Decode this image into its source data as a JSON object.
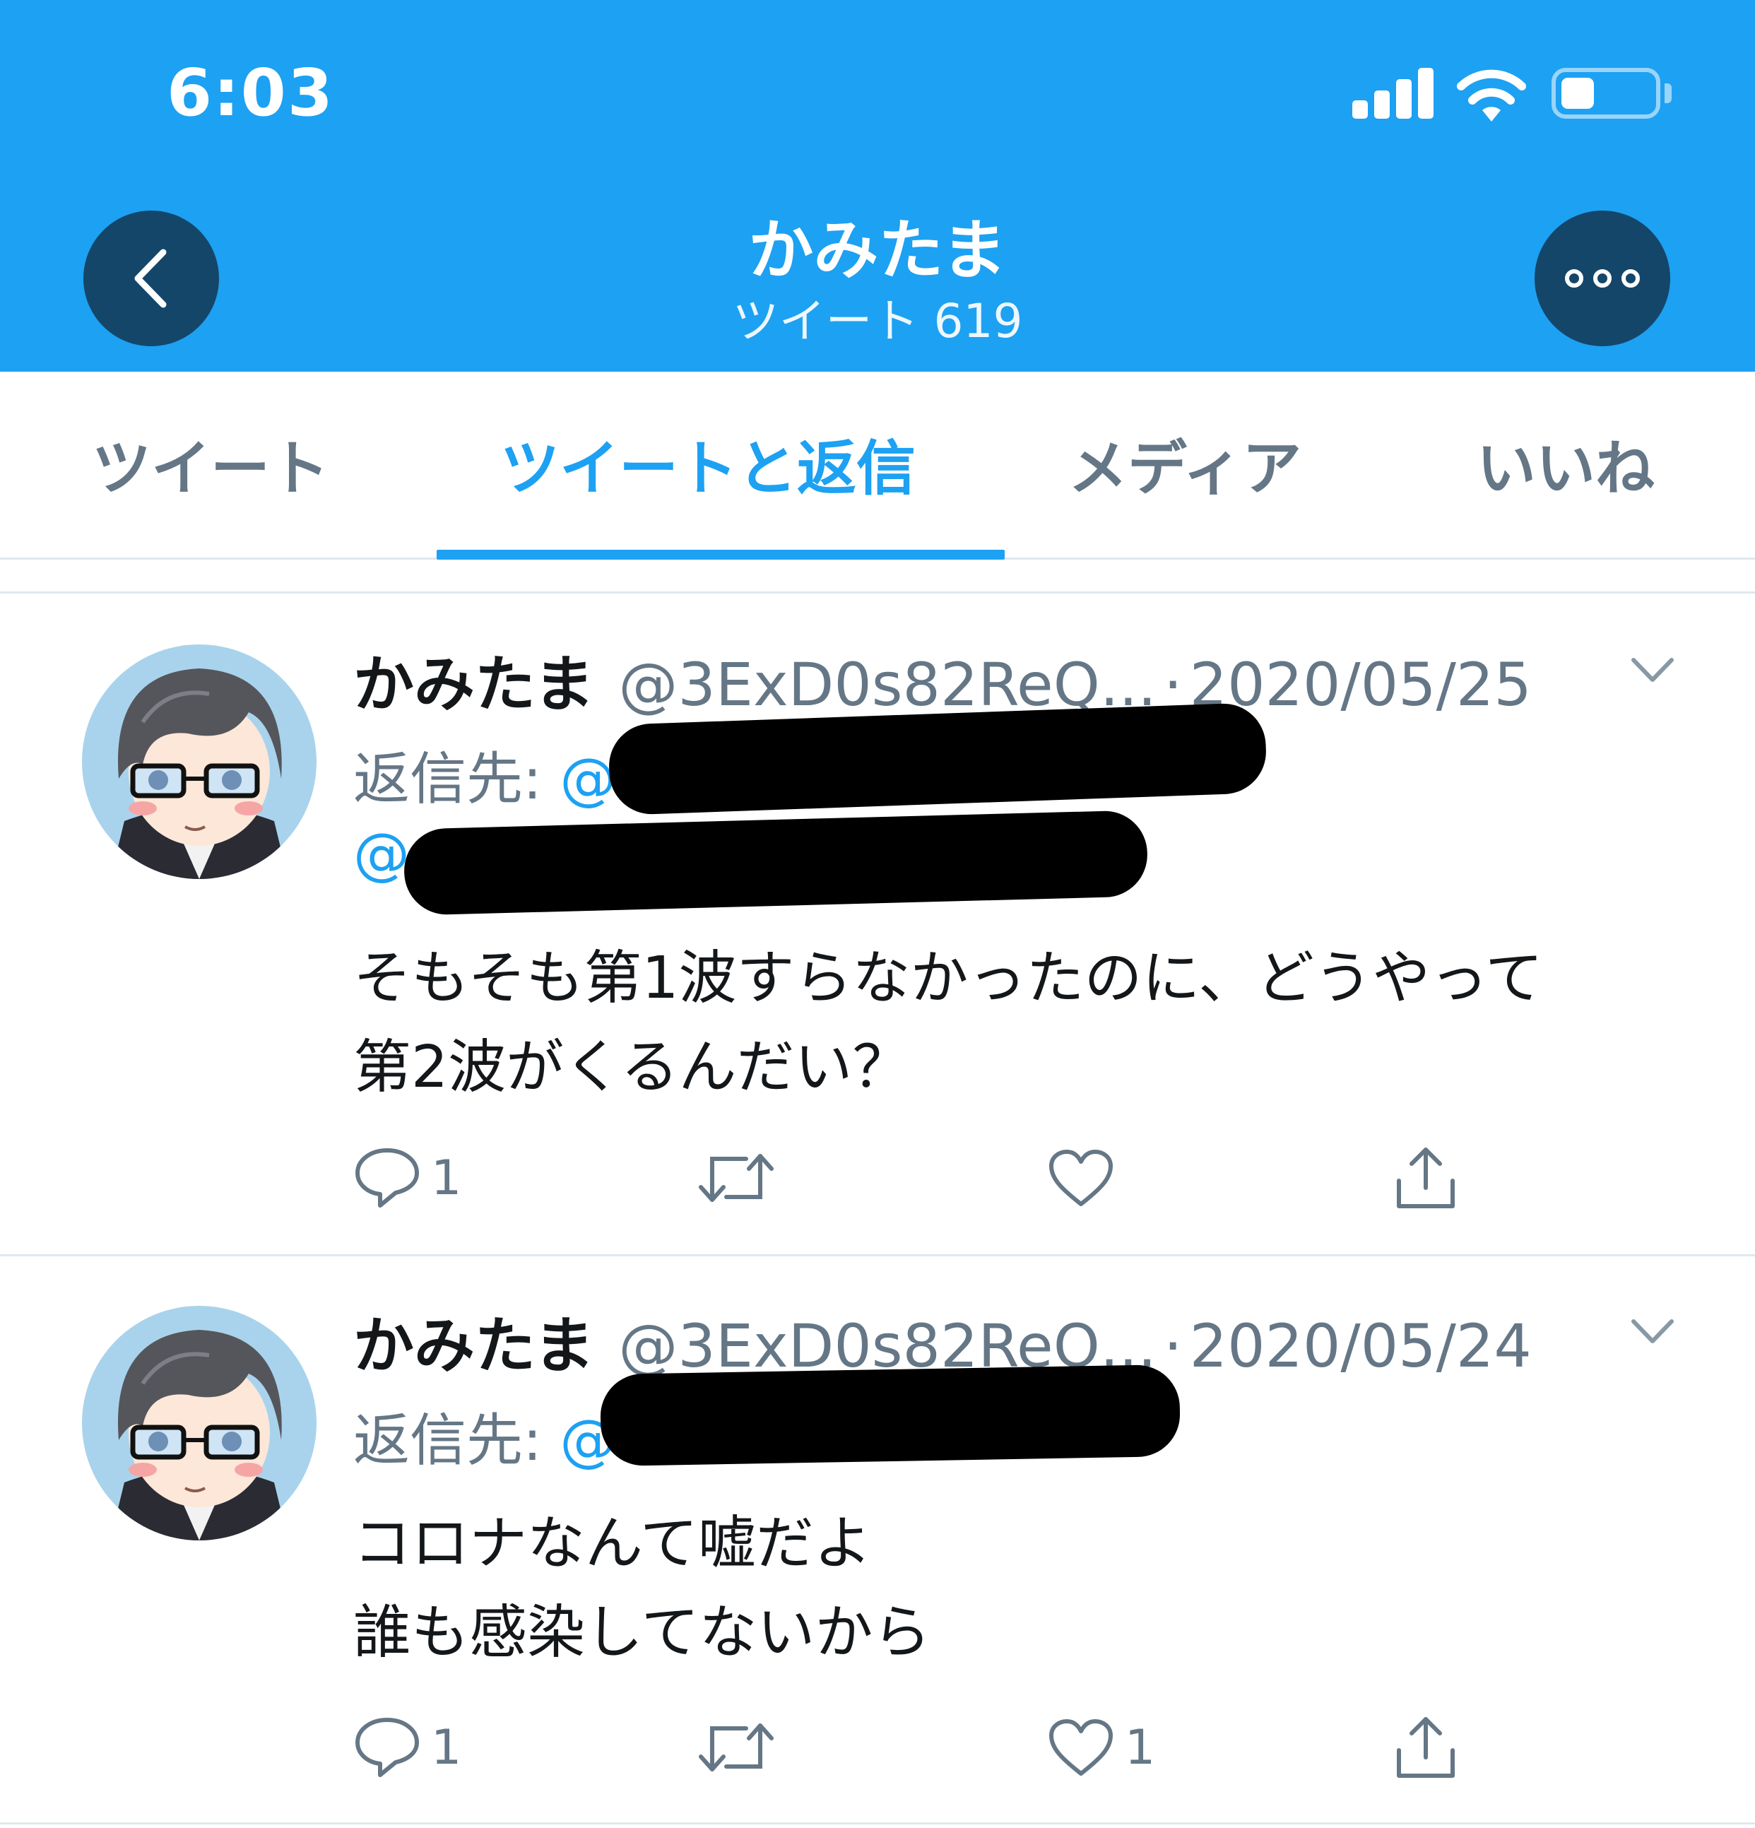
{
  "status_bar": {
    "time": "6:03"
  },
  "header": {
    "name": "かみたま",
    "tweet_count": "ツイート 619",
    "back_icon": "chevron-left-icon",
    "more_icon": "more-horizontal-icon",
    "color": "#1da1f2"
  },
  "tabs": [
    {
      "label": "ツイート",
      "active": false
    },
    {
      "label": "ツイートと返信",
      "active": true
    },
    {
      "label": "メディア",
      "active": false
    },
    {
      "label": "いいね",
      "active": false
    }
  ],
  "tweets": [
    {
      "name": "かみたま",
      "handle": "@3ExD0s82ReQ...",
      "separator": "·",
      "date": "2020/05/25",
      "reply_label": "返信先: ",
      "reply_mention_1": "@",
      "reply_mention_2": "@",
      "text_line_1": "そもそも第1波すらなかったのに、どうやって",
      "text_line_2": "第2波がくるんだい？",
      "reply_count": "1",
      "retweet_count": "",
      "like_count": ""
    },
    {
      "name": "かみたま",
      "handle": "@3ExD0s82ReQ...",
      "separator": "·",
      "date": "2020/05/24",
      "reply_label": "返信先: ",
      "reply_mention_1": "@",
      "text_line_1": "コロナなんて嘘だよ",
      "text_line_2": "誰も感染してないから",
      "reply_count": "1",
      "retweet_count": "",
      "like_count": "1"
    }
  ],
  "colors": {
    "accent": "#1da1f2",
    "secondary_text": "#657786",
    "border": "#e1e8ed",
    "header_button": "#14466a"
  }
}
